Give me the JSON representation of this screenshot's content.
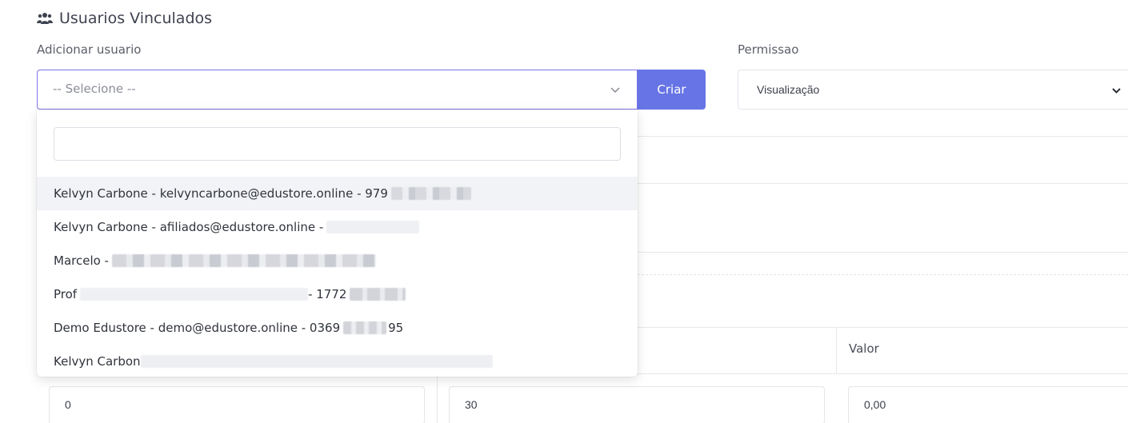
{
  "section": {
    "title": "Usuarios Vinculados",
    "icon": "users-icon"
  },
  "form": {
    "add_user_label": "Adicionar usuario",
    "user_select_placeholder": "-- Selecione --",
    "create_button_label": "Criar",
    "permission_label": "Permissao",
    "permission_value": "Visualização"
  },
  "dropdown": {
    "search_value": "",
    "options": [
      {
        "text": "Kelvyn Carbone - kelvyncarbone@edustore.online - 979",
        "redacted": true
      },
      {
        "text": "Kelvyn Carbone - afiliados@edustore.online - ",
        "redacted": true
      },
      {
        "text": "Marcelo - ",
        "redacted": true
      },
      {
        "text": "Prof",
        "suffix": " - 1772",
        "redacted": true
      },
      {
        "text": "Demo Edustore - demo@edustore.online - 0369",
        "suffix": "95",
        "redacted": true
      },
      {
        "text": "Kelvyn Carbon",
        "redacted": true
      }
    ]
  },
  "table": {
    "header_valor": "Valor",
    "row": {
      "col1": "0",
      "col2": "30",
      "col3": "0,00"
    }
  },
  "colors": {
    "accent": "#6774e6",
    "focus_border": "#7b74e8"
  }
}
